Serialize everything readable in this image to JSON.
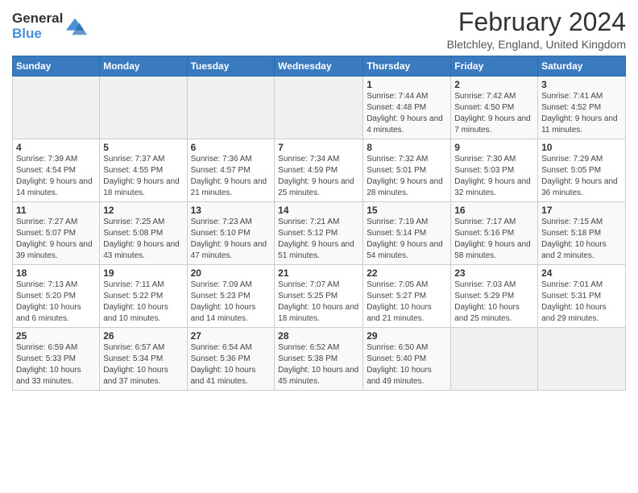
{
  "header": {
    "logo_line1": "General",
    "logo_line2": "Blue",
    "title": "February 2024",
    "subtitle": "Bletchley, England, United Kingdom"
  },
  "calendar": {
    "days_of_week": [
      "Sunday",
      "Monday",
      "Tuesday",
      "Wednesday",
      "Thursday",
      "Friday",
      "Saturday"
    ],
    "weeks": [
      [
        {
          "day": "",
          "info": ""
        },
        {
          "day": "",
          "info": ""
        },
        {
          "day": "",
          "info": ""
        },
        {
          "day": "",
          "info": ""
        },
        {
          "day": "1",
          "info": "Sunrise: 7:44 AM\nSunset: 4:48 PM\nDaylight: 9 hours and 4 minutes."
        },
        {
          "day": "2",
          "info": "Sunrise: 7:42 AM\nSunset: 4:50 PM\nDaylight: 9 hours and 7 minutes."
        },
        {
          "day": "3",
          "info": "Sunrise: 7:41 AM\nSunset: 4:52 PM\nDaylight: 9 hours and 11 minutes."
        }
      ],
      [
        {
          "day": "4",
          "info": "Sunrise: 7:39 AM\nSunset: 4:54 PM\nDaylight: 9 hours and 14 minutes."
        },
        {
          "day": "5",
          "info": "Sunrise: 7:37 AM\nSunset: 4:55 PM\nDaylight: 9 hours and 18 minutes."
        },
        {
          "day": "6",
          "info": "Sunrise: 7:36 AM\nSunset: 4:57 PM\nDaylight: 9 hours and 21 minutes."
        },
        {
          "day": "7",
          "info": "Sunrise: 7:34 AM\nSunset: 4:59 PM\nDaylight: 9 hours and 25 minutes."
        },
        {
          "day": "8",
          "info": "Sunrise: 7:32 AM\nSunset: 5:01 PM\nDaylight: 9 hours and 28 minutes."
        },
        {
          "day": "9",
          "info": "Sunrise: 7:30 AM\nSunset: 5:03 PM\nDaylight: 9 hours and 32 minutes."
        },
        {
          "day": "10",
          "info": "Sunrise: 7:29 AM\nSunset: 5:05 PM\nDaylight: 9 hours and 36 minutes."
        }
      ],
      [
        {
          "day": "11",
          "info": "Sunrise: 7:27 AM\nSunset: 5:07 PM\nDaylight: 9 hours and 39 minutes."
        },
        {
          "day": "12",
          "info": "Sunrise: 7:25 AM\nSunset: 5:08 PM\nDaylight: 9 hours and 43 minutes."
        },
        {
          "day": "13",
          "info": "Sunrise: 7:23 AM\nSunset: 5:10 PM\nDaylight: 9 hours and 47 minutes."
        },
        {
          "day": "14",
          "info": "Sunrise: 7:21 AM\nSunset: 5:12 PM\nDaylight: 9 hours and 51 minutes."
        },
        {
          "day": "15",
          "info": "Sunrise: 7:19 AM\nSunset: 5:14 PM\nDaylight: 9 hours and 54 minutes."
        },
        {
          "day": "16",
          "info": "Sunrise: 7:17 AM\nSunset: 5:16 PM\nDaylight: 9 hours and 58 minutes."
        },
        {
          "day": "17",
          "info": "Sunrise: 7:15 AM\nSunset: 5:18 PM\nDaylight: 10 hours and 2 minutes."
        }
      ],
      [
        {
          "day": "18",
          "info": "Sunrise: 7:13 AM\nSunset: 5:20 PM\nDaylight: 10 hours and 6 minutes."
        },
        {
          "day": "19",
          "info": "Sunrise: 7:11 AM\nSunset: 5:22 PM\nDaylight: 10 hours and 10 minutes."
        },
        {
          "day": "20",
          "info": "Sunrise: 7:09 AM\nSunset: 5:23 PM\nDaylight: 10 hours and 14 minutes."
        },
        {
          "day": "21",
          "info": "Sunrise: 7:07 AM\nSunset: 5:25 PM\nDaylight: 10 hours and 18 minutes."
        },
        {
          "day": "22",
          "info": "Sunrise: 7:05 AM\nSunset: 5:27 PM\nDaylight: 10 hours and 21 minutes."
        },
        {
          "day": "23",
          "info": "Sunrise: 7:03 AM\nSunset: 5:29 PM\nDaylight: 10 hours and 25 minutes."
        },
        {
          "day": "24",
          "info": "Sunrise: 7:01 AM\nSunset: 5:31 PM\nDaylight: 10 hours and 29 minutes."
        }
      ],
      [
        {
          "day": "25",
          "info": "Sunrise: 6:59 AM\nSunset: 5:33 PM\nDaylight: 10 hours and 33 minutes."
        },
        {
          "day": "26",
          "info": "Sunrise: 6:57 AM\nSunset: 5:34 PM\nDaylight: 10 hours and 37 minutes."
        },
        {
          "day": "27",
          "info": "Sunrise: 6:54 AM\nSunset: 5:36 PM\nDaylight: 10 hours and 41 minutes."
        },
        {
          "day": "28",
          "info": "Sunrise: 6:52 AM\nSunset: 5:38 PM\nDaylight: 10 hours and 45 minutes."
        },
        {
          "day": "29",
          "info": "Sunrise: 6:50 AM\nSunset: 5:40 PM\nDaylight: 10 hours and 49 minutes."
        },
        {
          "day": "",
          "info": ""
        },
        {
          "day": "",
          "info": ""
        }
      ]
    ]
  }
}
